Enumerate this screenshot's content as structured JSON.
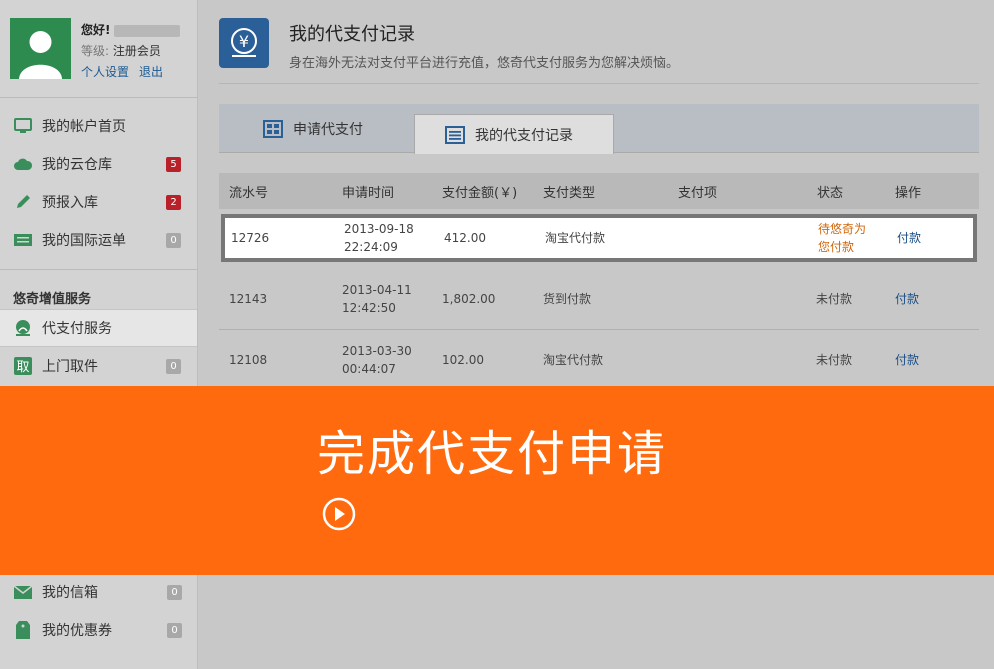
{
  "profile": {
    "greeting": "您好!",
    "level_label": "等级:",
    "level_value": "注册会员",
    "settings_link": "个人设置",
    "logout_link": "退出"
  },
  "nav_top": [
    {
      "label": "我的帐户首页",
      "icon": "monitor-icon",
      "badge": ""
    },
    {
      "label": "我的云仓库",
      "icon": "cloud-icon",
      "badge": "5",
      "badge_color": "#b8202a"
    },
    {
      "label": "预报入库",
      "icon": "pencil-icon",
      "badge": "2",
      "badge_color": "#b8202a"
    },
    {
      "label": "我的国际运单",
      "icon": "list-icon",
      "badge": "0",
      "badge_color": "#a8a8a8"
    }
  ],
  "section_title": "悠奇增值服务",
  "nav_service": [
    {
      "label": "代支付服务",
      "icon": "payment-icon",
      "active": true
    },
    {
      "label": "上门取件",
      "icon": "pickup-icon",
      "badge": "0"
    }
  ],
  "nav_bottom": [
    {
      "label": "我的信箱",
      "icon": "mail-icon",
      "badge": "0"
    },
    {
      "label": "我的优惠券",
      "icon": "coupon-icon",
      "badge": "0"
    }
  ],
  "header": {
    "title": "我的代支付记录",
    "subtitle": "身在海外无法对支付平台进行充值，悠奇代支付服务为您解决烦恼。"
  },
  "tabs": [
    {
      "label": "申请代支付",
      "icon": "grid-icon"
    },
    {
      "label": "我的代支付记录",
      "icon": "list-icon",
      "active": true
    }
  ],
  "table": {
    "headers": [
      "流水号",
      "申请时间",
      "支付金额(￥)",
      "支付类型",
      "支付项",
      "状态",
      "操作"
    ],
    "rows": [
      {
        "id": "12726",
        "date": "2013-09-18",
        "time": "22:24:09",
        "amount": "412.00",
        "type": "淘宝代付款",
        "item": "",
        "status_1": "待悠奇为",
        "status_2": "您付款",
        "action": "付款",
        "highlight": true
      },
      {
        "id": "12143",
        "date": "2013-04-11",
        "time": "12:42:50",
        "amount": "1,802.00",
        "type": "货到付款",
        "item": "",
        "status_1": "未付款",
        "status_2": "",
        "action": "付款"
      },
      {
        "id": "12108",
        "date": "2013-03-30",
        "time": "00:44:07",
        "amount": "102.00",
        "type": "淘宝代付款",
        "item": "",
        "status_1": "未付款",
        "status_2": "",
        "action": "付款"
      }
    ]
  },
  "banner": {
    "title": "完成代支付申请",
    "color": "#ff6a0e"
  },
  "colors": {
    "link": "#1b4f86",
    "pending": "#d1660a",
    "badge_red": "#b8202a",
    "icon_green": "#3a8e5c"
  }
}
